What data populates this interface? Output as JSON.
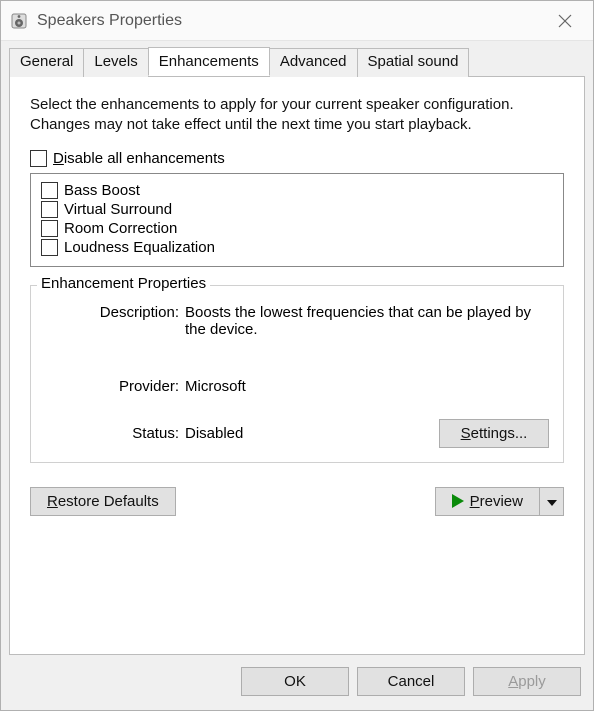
{
  "window": {
    "title": "Speakers Properties"
  },
  "tabs": {
    "items": [
      {
        "label": "General"
      },
      {
        "label": "Levels"
      },
      {
        "label": "Enhancements"
      },
      {
        "label": "Advanced"
      },
      {
        "label": "Spatial sound"
      }
    ],
    "active_index": 2
  },
  "panel": {
    "intro": "Select the enhancements to apply for your current speaker configuration. Changes may not take effect until the next time you start playback.",
    "disable_all_pre": "D",
    "disable_all_post": "isable all enhancements",
    "enhancements": [
      {
        "label": "Bass Boost"
      },
      {
        "label": "Virtual Surround"
      },
      {
        "label": "Room Correction"
      },
      {
        "label": "Loudness Equalization"
      }
    ],
    "properties_legend": "Enhancement Properties",
    "desc_label": "Description:",
    "desc_value": "Boosts the lowest frequencies that can be played by the device.",
    "provider_label": "Provider:",
    "provider_value": "Microsoft",
    "status_label": "Status:",
    "status_value": "Disabled",
    "settings_pre": "S",
    "settings_post": "ettings...",
    "restore_pre": "R",
    "restore_post": "estore Defaults",
    "preview_pre": "P",
    "preview_post": "review"
  },
  "buttons": {
    "ok": "OK",
    "cancel": "Cancel",
    "apply_pre": "A",
    "apply_post": "pply"
  }
}
